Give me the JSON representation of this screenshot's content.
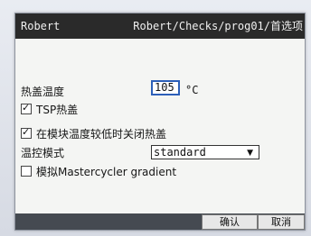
{
  "titlebar": {
    "left": "Robert",
    "right": "Robert/Checks/prog01/首选项"
  },
  "settings": {
    "lid_temp_label": "热盖温度",
    "lid_temp_value": "105",
    "lid_temp_unit": "°C",
    "tsp_lid_label": "TSP热盖",
    "tsp_lid_checked": true,
    "auto_off_label": "在模块温度较低时关闭热盖",
    "auto_off_checked": true,
    "control_mode_label": "温控模式",
    "control_mode_value": "standard",
    "simulate_label": "模拟Mastercycler gradient",
    "simulate_checked": false
  },
  "buttons": {
    "ok": "确认",
    "cancel": "取消"
  },
  "icons": {
    "dropdown": "chevron-down-icon",
    "checkbox": "checkmark-icon"
  },
  "colors": {
    "titlebar_bg": "#2a2a2a",
    "input_border": "#2c5fb8",
    "bottombar_bg": "#454a51"
  }
}
